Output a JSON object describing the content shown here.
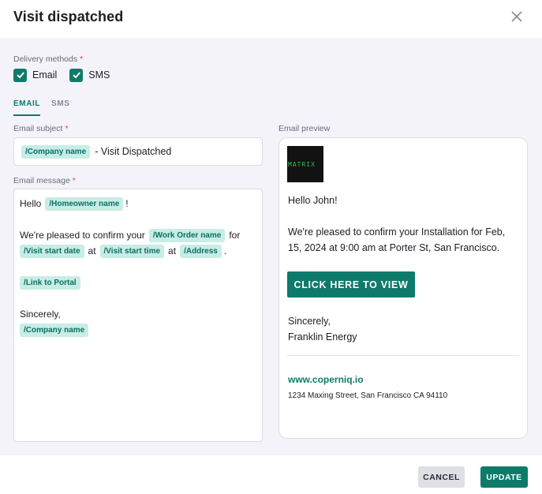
{
  "dialog": {
    "title": "Visit dispatched"
  },
  "delivery": {
    "label": "Delivery methods",
    "required": "*",
    "options": [
      {
        "label": "Email",
        "checked": true
      },
      {
        "label": "SMS",
        "checked": true
      }
    ]
  },
  "tabs": [
    {
      "label": "EMAIL",
      "active": true
    },
    {
      "label": "SMS",
      "active": false
    }
  ],
  "subject": {
    "label": "Email subject",
    "required": "*",
    "token": "/Company name",
    "text": "- Visit Dispatched"
  },
  "message": {
    "label": "Email message",
    "required": "*",
    "greeting": "Hello",
    "greeting_token": "/Homeowner name",
    "greeting_end": "!",
    "confirm_text": "We're pleased to confirm your",
    "work_order_token": "/Work Order name",
    "for_text": "for",
    "start_date_token": "/Visit start date",
    "at_text_1": "at",
    "start_time_token": "/Visit start time",
    "at_text_2": "at",
    "address_token": "/Address",
    "period": ".",
    "portal_token": "/Link to Portal",
    "closing": "Sincerely,",
    "closing_token": "/Company name"
  },
  "preview": {
    "label": "Email preview",
    "logo_text": "MATRIX",
    "greeting": "Hello John!",
    "body": "We're pleased to confirm your Installation for Feb, 15, 2024 at 9:00 am at Porter St, San Francisco.",
    "button": "CLICK HERE TO VIEW",
    "closing": "Sincerely,",
    "company": "Franklin Energy",
    "link": "www.coperniq.io",
    "address": "1234 Maxing Street, San Francisco CA 94110"
  },
  "footer": {
    "cancel": "CANCEL",
    "update": "UPDATE"
  },
  "colors": {
    "accent": "#0e7a6a",
    "chip_bg": "#c8ece6",
    "panel_bg": "#f3f3f9",
    "required": "#d6454b"
  }
}
